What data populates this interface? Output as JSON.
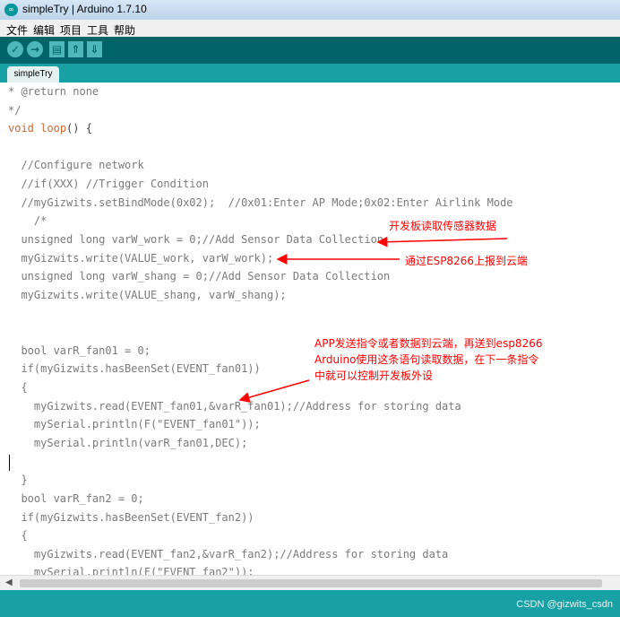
{
  "window": {
    "title": "simpleTry | Arduino 1.7.10",
    "icon": "arduino-icon"
  },
  "menu": [
    "文件",
    "编辑",
    "项目",
    "工具",
    "帮助"
  ],
  "toolbar": {
    "buttons": [
      {
        "name": "verify-icon",
        "glyph": "✓"
      },
      {
        "name": "upload-icon",
        "glyph": "→"
      },
      {
        "name": "new-icon",
        "glyph": "▤"
      },
      {
        "name": "open-icon",
        "glyph": "⇑"
      },
      {
        "name": "save-icon",
        "glyph": "⇓"
      }
    ]
  },
  "tab": {
    "label": "simpleTry"
  },
  "code": {
    "lines": [
      "* @return none",
      "*/",
      "void loop() {",
      "",
      "  //Configure network",
      "  //if(XXX) //Trigger Condition",
      "  //myGizwits.setBindMode(0x02);  //0x01:Enter AP Mode;0x02:Enter Airlink Mode",
      "    /*",
      "  unsigned long varW_work = 0;//Add Sensor Data Collection",
      "  myGizwits.write(VALUE_work, varW_work);",
      "  unsigned long varW_shang = 0;//Add Sensor Data Collection",
      "  myGizwits.write(VALUE_shang, varW_shang);",
      "",
      "",
      "  bool varR_fan01 = 0;",
      "  if(myGizwits.hasBeenSet(EVENT_fan01))",
      "  {",
      "    myGizwits.read(EVENT_fan01,&varR_fan01);//Address for storing data",
      "    mySerial.println(F(\"EVENT_fan01\"));",
      "    mySerial.println(varR_fan01,DEC);",
      "",
      "  }",
      "  bool varR_fan2 = 0;",
      "  if(myGizwits.hasBeenSet(EVENT_fan2))",
      "  {",
      "    myGizwits.read(EVENT_fan2,&varR_fan2);//Address for storing data",
      "    mySerial.println(F(\"EVENT_fan2\"));"
    ]
  },
  "annotations": {
    "a1": "开发板读取传感器数据",
    "a2": "通过ESP8266上报到云端",
    "a3_line1": "APP发送指令或者数据到云端，再送到esp8266",
    "a3_line2": "Arduino使用这条语句读取数据，在下一条指令",
    "a3_line3": "中就可以控制开发板外设"
  },
  "status": {
    "watermark": "CSDN @gizwits_csdn"
  },
  "colors": {
    "toolbar": "#006468",
    "tabbar": "#17a1a5",
    "annotation": "#ff0000",
    "comment": "#7a7a7a",
    "keyword": "#cc6633"
  }
}
